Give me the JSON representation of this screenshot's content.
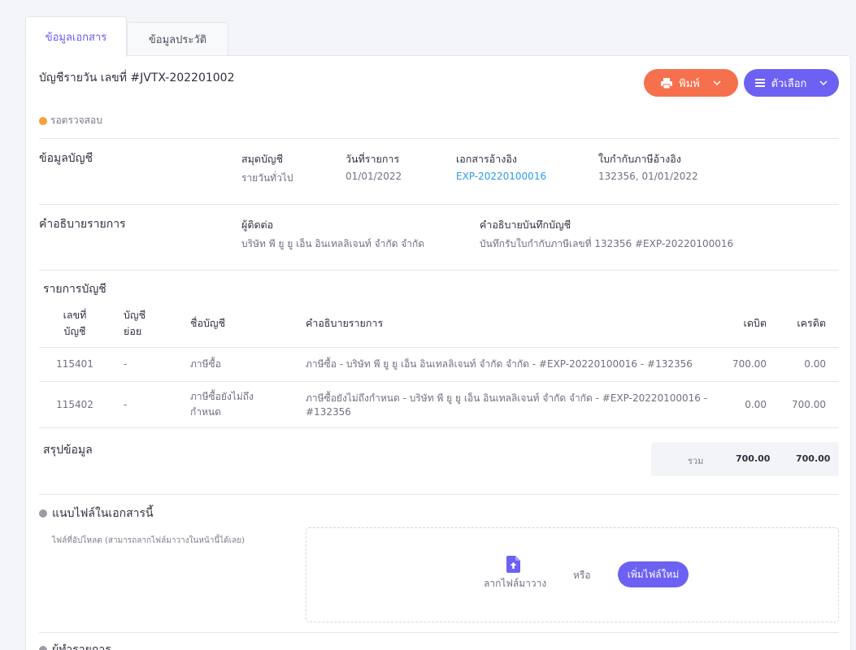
{
  "tabs": [
    {
      "label": "ข้อมูลเอกสาร"
    },
    {
      "label": "ข้อมูลประวัติ"
    }
  ],
  "document": {
    "title": "บัญชีรายวัน เลขที่ #JVTX-202201002",
    "status": "รอตรวจสอบ",
    "status_color": "#f5a13b"
  },
  "actions": {
    "print_label": "พิมพ์",
    "options_label": "ตัวเลือก",
    "print_color": "#f6704d",
    "options_color": "#6c61f2"
  },
  "account_info": {
    "section_title": "ข้อมูลบัญชี",
    "journal_label": "สมุดบัญชี",
    "journal_value": "รายวันทั่วไป",
    "date_label": "วันที่รายการ",
    "date_value": "01/01/2022",
    "ref_doc_label": "เอกสารอ้างอิง",
    "ref_doc_value": "EXP-20220100016",
    "tax_invoice_label": "ใบกำกับภาษีอ้างอิง",
    "tax_invoice_value": "132356, 01/01/2022"
  },
  "description": {
    "section_title": "คำอธิบายรายการ",
    "contact_label": "ผู้ติดต่อ",
    "contact_value": "บริษัท พี ยู ยู เอ็น อินเทลลิเจนท์ จำกัด จำกัด",
    "memo_label": "คำอธิบายบันทึกบัญชี",
    "memo_value": "บันทึกรับใบกำกับภาษีเลขที่ 132356 #EXP-20220100016"
  },
  "entries": {
    "section_title": "รายการบัญชี",
    "headers": {
      "account_no_line1": "เลขที่",
      "account_no_line2": "บัญชี",
      "sub_account_line1": "บัญชี",
      "sub_account_line2": "ย่อย",
      "account_name": "ชื่อบัญชี",
      "description": "คำอธิบายรายการ",
      "debit": "เดบิต",
      "credit": "เครดิต"
    },
    "rows": [
      {
        "account_no": "115401",
        "sub_account": "-",
        "account_name": "ภาษีซื้อ",
        "description": "ภาษีซื้อ - บริษัท พี ยู ยู เอ็น อินเทลลิเจนท์ จำกัด จำกัด - #EXP-20220100016 - #132356",
        "debit": "700.00",
        "credit": "0.00"
      },
      {
        "account_no": "115402",
        "sub_account": "-",
        "account_name_line1": "ภาษีซื้อยังไม่ถึง",
        "account_name_line2": "กำหนด",
        "description_line1": "ภาษีซื้อยังไม่ถึงกำหนด - บริษัท พี ยู ยู เอ็น อินเทลลิเจนท์ จำกัด จำกัด - #EXP-20220100016 -",
        "description_line2": "#132356",
        "debit": "0.00",
        "credit": "700.00"
      }
    ]
  },
  "summary": {
    "section_title": "สรุปข้อมูล",
    "total_label": "รวม",
    "total_debit": "700.00",
    "total_credit": "700.00"
  },
  "attachments": {
    "section_title": "แนบไฟล์ในเอกสารนี้",
    "hint": "ไฟล์ที่อัปโหลด (สามารถลากไฟล์มาวางในหน้านี้ได้เลย)",
    "drag_text": "ลากไฟล์มาวาง",
    "or_text": "หรือ",
    "add_button": "เพิ่มไฟล์ใหม่"
  },
  "creator": {
    "section_title": "ผู้ทำรายการ"
  }
}
